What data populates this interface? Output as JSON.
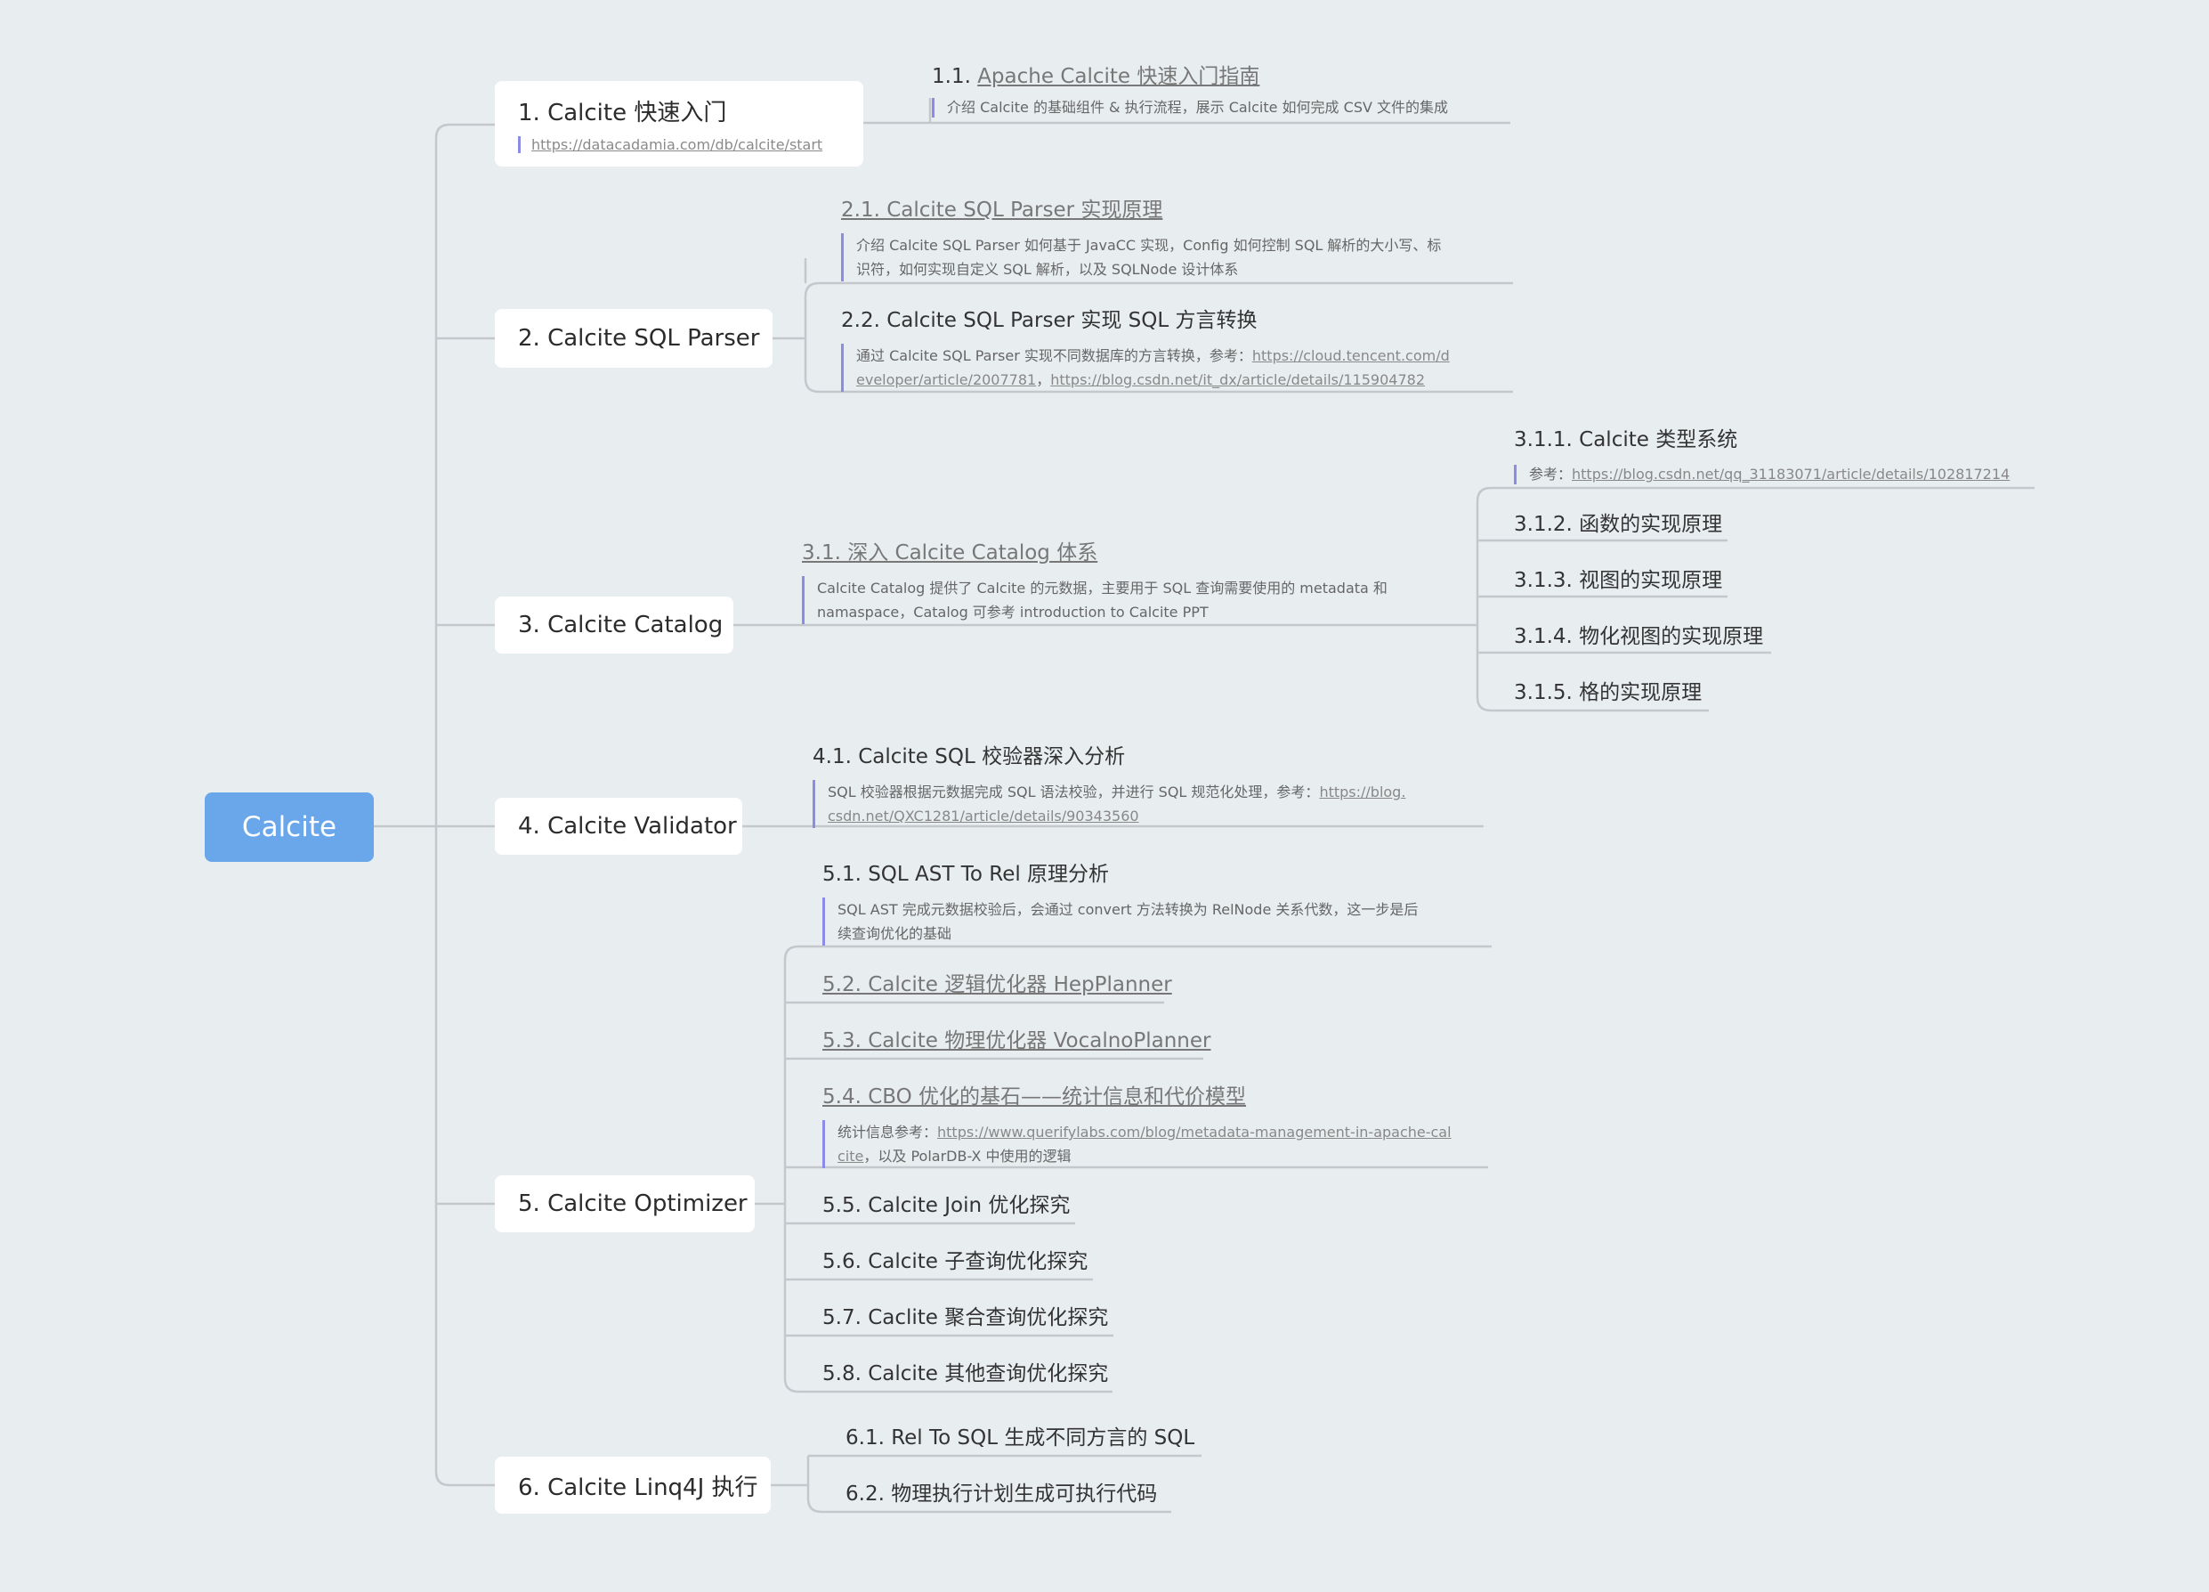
{
  "root": {
    "label": "Calcite"
  },
  "branches": {
    "b1": {
      "title": "1. Calcite 快速入门",
      "note": "https://datacadamia.com/db/calcite/start",
      "c1": {
        "number": "1.1.",
        "title": "Apache Calcite 快速入门指南",
        "note": "介绍 Calcite 的基础组件 & 执行流程，展示 Calcite 如何完成 CSV 文件的集成"
      }
    },
    "b2": {
      "title": "2. Calcite SQL Parser",
      "c1": {
        "title": "2.1. Calcite SQL Parser 实现原理",
        "note_line1": "介绍 Calcite SQL Parser 如何基于 JavaCC 实现，Config 如何控制 SQL 解析的大小写、标",
        "note_line2": "识符，如何实现自定义 SQL 解析，以及 SQLNode 设计体系"
      },
      "c2": {
        "title": "2.2. Calcite SQL Parser 实现 SQL 方言转换",
        "note_prefix": "通过 Calcite SQL Parser 实现不同数据库的方言转换，参考：",
        "link1_part1": "https://cloud.tencent.com/d",
        "link1_part2": "eveloper/article/2007781",
        "sep": "，",
        "link2": "https://blog.csdn.net/it_dx/article/details/115904782"
      }
    },
    "b3": {
      "title": "3. Calcite Catalog",
      "c1": {
        "title": "3.1. 深入 Calcite Catalog 体系",
        "note_line1": "Calcite Catalog 提供了 Calcite 的元数据，主要用于 SQL 查询需要使用的 metadata 和",
        "note_line2": "namaspace，Catalog 可参考 introduction to Calcite PPT",
        "g1": {
          "title": "3.1.1. Calcite 类型系统",
          "note_prefix": "参考：",
          "note_link": "https://blog.csdn.net/qq_31183071/article/details/102817214"
        },
        "g2": {
          "title": "3.1.2. 函数的实现原理"
        },
        "g3": {
          "title": "3.1.3. 视图的实现原理"
        },
        "g4": {
          "title": "3.1.4. 物化视图的实现原理"
        },
        "g5": {
          "title": "3.1.5. 格的实现原理"
        }
      }
    },
    "b4": {
      "title": "4. Calcite Validator",
      "c1": {
        "title": "4.1. Calcite SQL 校验器深入分析",
        "note_prefix": "SQL 校验器根据元数据完成 SQL 语法校验，并进行 SQL 规范化处理，参考：",
        "link_part1": "https://blog.",
        "link_part2": "csdn.net/QXC1281/article/details/90343560"
      }
    },
    "b5": {
      "title": "5. Calcite Optimizer",
      "c1": {
        "title": "5.1. SQL AST To Rel 原理分析",
        "note_line1": "SQL AST 完成元数据校验后，会通过 convert 方法转换为 RelNode 关系代数，这一步是后",
        "note_line2": "续查询优化的基础"
      },
      "c2": {
        "title": "5.2. Calcite 逻辑优化器 HepPlanner"
      },
      "c3": {
        "title": "5.3. Calcite 物理优化器 VocalnoPlanner"
      },
      "c4": {
        "title": "5.4. CBO 优化的基石——统计信息和代价模型",
        "note_prefix": "统计信息参考：",
        "link_part1": "https://www.querifylabs.com/blog/metadata-management-in-apache-cal",
        "link_part2": "cite",
        "note_suffix": "，以及 PolarDB-X 中使用的逻辑"
      },
      "c5": {
        "title": "5.5. Calcite Join 优化探究"
      },
      "c6": {
        "title": "5.6. Calcite 子查询优化探究"
      },
      "c7": {
        "title": "5.7. Caclite 聚合查询优化探究"
      },
      "c8": {
        "title": "5.8. Calcite 其他查询优化探究"
      }
    },
    "b6": {
      "title": "6. Calcite Linq4J 执行",
      "c1": {
        "title": "6.1. Rel To SQL 生成不同方言的 SQL"
      },
      "c2": {
        "title": "6.2. 物理执行计划生成可执行代码"
      }
    }
  },
  "colors": {
    "background": "#e8edf0",
    "root": "#6aa6ea",
    "connector": "#c4c8cc",
    "note_bar": "#8c8ce6"
  }
}
